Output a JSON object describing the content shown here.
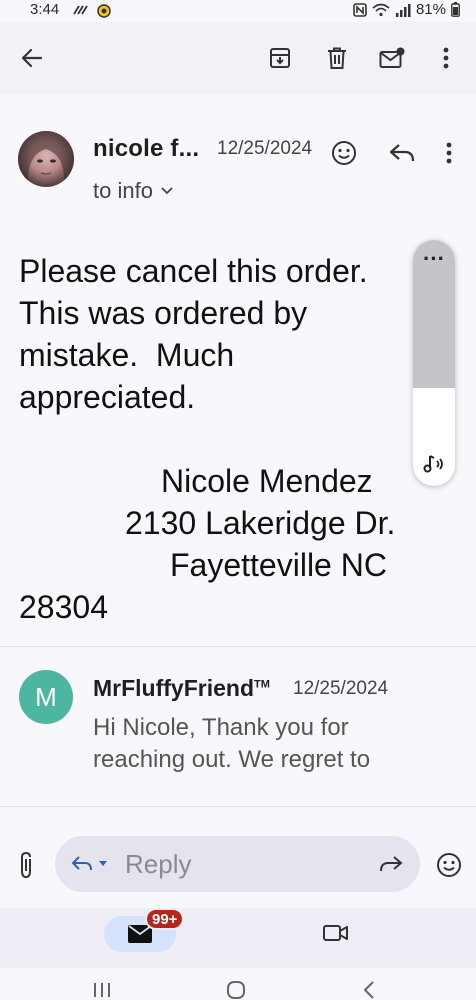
{
  "status_bar": {
    "time": "3:44",
    "battery": "81%"
  },
  "toolbar": {
    "icons": [
      "back-arrow-icon",
      "archive-icon",
      "delete-icon",
      "mark-unread-icon",
      "more-vertical-icon"
    ]
  },
  "message": {
    "sender_name": "nicole f...",
    "date": "12/25/2024",
    "recipient": "to info",
    "body_lines": [
      "Please cancel this order.",
      "This was ordered by",
      "mistake.  Much",
      "appreciated."
    ],
    "signature": {
      "name": "Nicole Mendez",
      "street": "2130 Lakeridge Dr.",
      "city": "Fayetteville NC",
      "zip": "28304"
    }
  },
  "reply": {
    "avatar_letter": "M",
    "sender_name": "MrFluffyFriend",
    "trademark": "TM",
    "date": "12/25/2024",
    "snippet": "Hi Nicole, Thank you for reaching out. We regret to"
  },
  "compose": {
    "placeholder": "Reply"
  },
  "bottom_nav": {
    "mail_badge": "99+"
  },
  "colors": {
    "accent_green": "#4db6a0",
    "badge_red": "#b3261e",
    "mail_pill": "#d4e3fb"
  }
}
